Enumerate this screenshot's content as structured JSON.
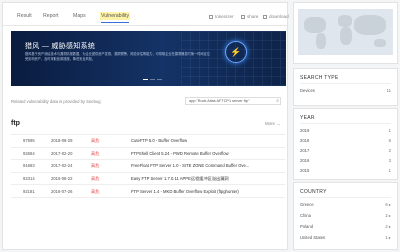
{
  "tabs": [
    {
      "label": "Result",
      "active": false
    },
    {
      "label": "Report",
      "active": false
    },
    {
      "label": "Maps",
      "active": false
    },
    {
      "label": "Vulnerability",
      "active": true
    }
  ],
  "options": {
    "tokenizer": "tokenizer",
    "share": "share",
    "download": "download"
  },
  "banner": {
    "title": "猎风 — 威胁感知系统",
    "description": "猎风基于资产测绘技术与漏洞情报数据，为企业提供资产发现、漏洞预警、风险评估等能力，可帮助企业在漏洞爆发时第一时间定位受影响资产，及时采取处置措施，降低安全风险。"
  },
  "related_text": "Related vulnerability data is provided by Seebug",
  "search": {
    "value": "app:\"Rock Atlas AFTCP1 server ftp\""
  },
  "section": {
    "title": "ftp",
    "more": "More →"
  },
  "rows": [
    {
      "id": "97595",
      "date": "2018-08-29",
      "level": "高危",
      "title": "CuteFTP 5.0 - Buffer Overflow"
    },
    {
      "id": "92684",
      "date": "2017-02-20",
      "level": "高危",
      "title": "FTPShell Client 5.24 - PWD Remote Buffer Overflow"
    },
    {
      "id": "91683",
      "date": "2017-02-24",
      "level": "高危",
      "title": "FreeFloat FTP Server 1.0 - SITE ZONE Command Buffer Ove..."
    },
    {
      "id": "92314",
      "date": "2016-08-22",
      "level": "高危",
      "title": "Easy FTP Server 1.7.0.11 APPE远程缓冲区溢出漏洞"
    },
    {
      "id": "92181",
      "date": "2016-07-26",
      "level": "高危",
      "title": "FTP Server 1.4 - MKD Buffer Overflow Exploit (ftpghunter)"
    }
  ],
  "sidebar": {
    "search_type": {
      "title": "SEARCH TYPE",
      "items": [
        {
          "label": "Devices",
          "count": "11"
        }
      ]
    },
    "year": {
      "title": "YEAR",
      "items": [
        {
          "label": "2019",
          "count": "1"
        },
        {
          "label": "2018",
          "count": "6"
        },
        {
          "label": "2017",
          "count": "2"
        },
        {
          "label": "2016",
          "count": "3"
        },
        {
          "label": "2015",
          "count": "1"
        }
      ]
    },
    "country": {
      "title": "COUNTRY",
      "items": [
        {
          "label": "Greece",
          "count": "6 ▸"
        },
        {
          "label": "China",
          "count": "2 ▸"
        },
        {
          "label": "Poland",
          "count": "2 ▸"
        },
        {
          "label": "United States",
          "count": "1 ▸"
        }
      ]
    }
  },
  "colors": {
    "accent": "#3a6fd8",
    "danger": "#e03b3b",
    "banner_bg": "#0a1c3f"
  }
}
